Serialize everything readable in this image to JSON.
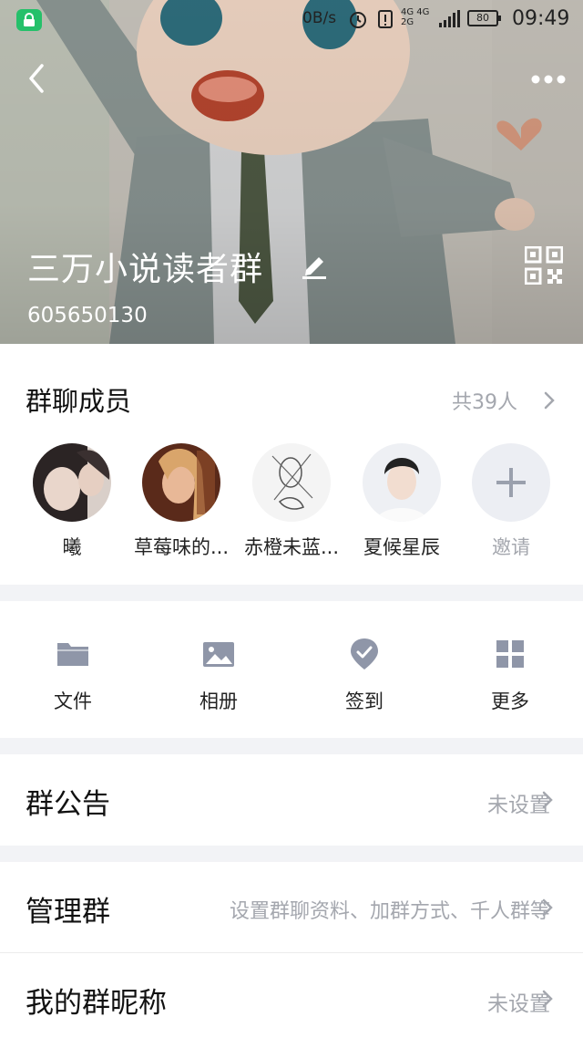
{
  "status_bar": {
    "net_speed": "0B/s",
    "net_type_top": "4G 4G",
    "net_type_bottom": "2G",
    "battery": "80",
    "time": "09:49"
  },
  "header": {
    "group_name": "三万小说读者群",
    "group_id": "605650130"
  },
  "members": {
    "title": "群聊成员",
    "count_label": "共39人",
    "list": [
      {
        "name": "曦"
      },
      {
        "name": "草莓味的..."
      },
      {
        "name": "赤橙未蓝..."
      },
      {
        "name": "夏候星辰"
      }
    ],
    "invite_label": "邀请"
  },
  "actions": [
    {
      "label": "文件",
      "icon": "folder-icon"
    },
    {
      "label": "相册",
      "icon": "image-icon"
    },
    {
      "label": "签到",
      "icon": "checkin-icon"
    },
    {
      "label": "更多",
      "icon": "grid-icon"
    }
  ],
  "settings": {
    "announcement": {
      "label": "群公告",
      "value": "未设置"
    },
    "manage": {
      "label": "管理群",
      "value": "设置群聊资料、加群方式、千人群等"
    },
    "nickname": {
      "label": "我的群昵称",
      "value": "未设置"
    }
  },
  "colors": {
    "accent_green": "#25c06a",
    "secondary_text": "#a4a7ae",
    "icon_gray": "#8f96a8",
    "separator": "#f2f3f6"
  }
}
